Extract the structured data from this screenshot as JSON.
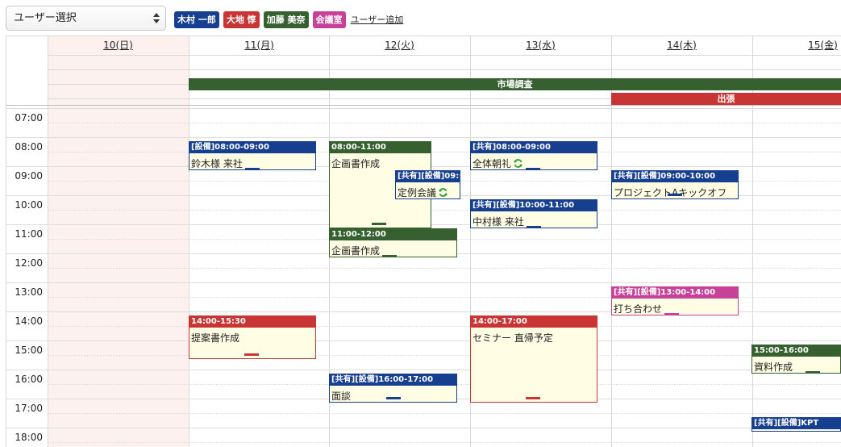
{
  "toolbar": {
    "user_select": "ユーザー選択",
    "users": [
      {
        "name": "木村 一郎",
        "color": "#173f8f"
      },
      {
        "name": "大地 惇",
        "color": "#c93434"
      },
      {
        "name": "加藤 美奈",
        "color": "#36602f"
      },
      {
        "name": "会議室",
        "color": "#c84198"
      }
    ],
    "add_user": "ユーザー追加"
  },
  "days": [
    "10(日)",
    "11(月)",
    "12(火)",
    "13(水)",
    "14(木)",
    "15(金)"
  ],
  "times": [
    "07:00",
    "08:00",
    "09:00",
    "10:00",
    "11:00",
    "12:00",
    "13:00",
    "14:00",
    "15:00",
    "16:00",
    "17:00",
    "18:00"
  ],
  "allday": {
    "market": "市場調査",
    "trip": "出張"
  },
  "events": {
    "e1": {
      "head": "[設備]08:00-09:00",
      "title": "鈴木様 来社"
    },
    "e2": {
      "head": "08:00-11:00",
      "title": "企画書作成"
    },
    "e3": {
      "head": "[共有][設備]09:0",
      "title": "定例会議"
    },
    "e4": {
      "head": "11:00-12:00",
      "title": "企画書作成"
    },
    "e5": {
      "head": "[共有][設備]16:00-17:00",
      "title": "面談"
    },
    "e6": {
      "head": "14:00-15:30",
      "title": "提案書作成"
    },
    "e7": {
      "head": "[共有]08:00-09:00",
      "title": "全体朝礼"
    },
    "e8": {
      "head": "[共有][設備]10:00-11:00",
      "title": "中村様 来社"
    },
    "e9": {
      "head": "14:00-17:00",
      "title": "セミナー 直帰予定"
    },
    "e10": {
      "head": "[共有][設備]09:00-10:00",
      "title": "プロジェクトAキックオフ"
    },
    "e11": {
      "head": "[共有][設備]13:00-14:00",
      "title": "打ち合わせ"
    },
    "e12": {
      "head": "15:00-16:00",
      "title": "資料作成"
    },
    "e13": {
      "head": "[共有][設備]KPT",
      "title": ""
    }
  },
  "colors": {
    "blue": "#173f8f",
    "red": "#c93434",
    "green": "#36602f",
    "magenta": "#c84198",
    "event_bg": "#fffde3",
    "sunday_bg": "#fdf1ef",
    "sync": "#2ea043"
  },
  "icons": {
    "sync": "sync-icon",
    "select": "chevron-updown-icon"
  }
}
